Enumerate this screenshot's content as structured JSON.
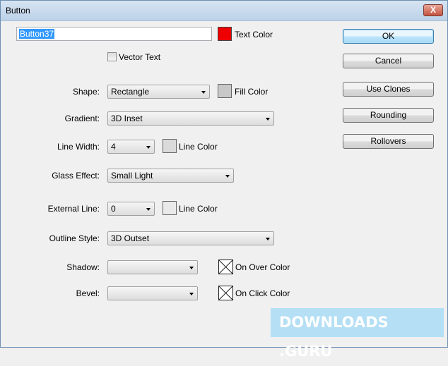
{
  "window": {
    "title": "Button",
    "close_label": "X"
  },
  "name_field": {
    "value": "Button37"
  },
  "text_color": {
    "label": "Text Color",
    "color": "#ee0000"
  },
  "vector_text": {
    "label": "Vector Text",
    "checked": false
  },
  "buttons": {
    "ok": "OK",
    "cancel": "Cancel",
    "use_clones": "Use Clones",
    "rounding": "Rounding",
    "rollovers": "Rollovers"
  },
  "shape": {
    "label": "Shape:",
    "value": "Rectangle",
    "swatch_label": "Fill Color",
    "color": "#c8c8c8"
  },
  "gradient": {
    "label": "Gradient:",
    "value": "3D Inset"
  },
  "line_width": {
    "label": "Line Width:",
    "value": "4",
    "swatch_label": "Line Color",
    "color": "#dadada"
  },
  "glass_effect": {
    "label": "Glass Effect:",
    "value": "Small Light"
  },
  "external_line": {
    "label": "External Line:",
    "value": "0",
    "swatch_label": "Line Color",
    "color": "#eaeaea"
  },
  "outline_style": {
    "label": "Outline Style:",
    "value": "3D Outset"
  },
  "shadow": {
    "label": "Shadow:",
    "value": "",
    "swatch_label": "On Over Color"
  },
  "bevel": {
    "label": "Bevel:",
    "value": "",
    "swatch_label": "On Click Color"
  },
  "watermark": {
    "text": "DOWNLOADS .GURU"
  }
}
